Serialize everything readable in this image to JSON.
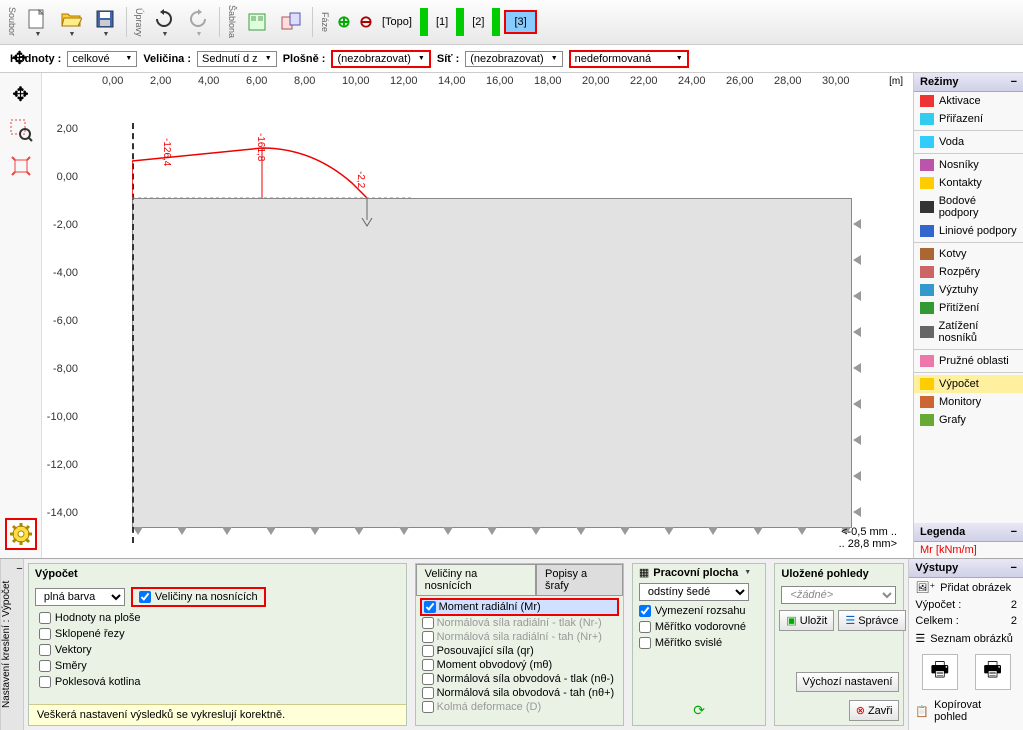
{
  "toolbar": {
    "file_label": "Soubor",
    "edit_label": "Úpravy",
    "template_label": "Šablona",
    "phase_label": "Fáze",
    "phases": [
      "[Topo]",
      "[1]",
      "[2]",
      "[3]"
    ]
  },
  "filters": {
    "hodnoty_label": "Hodnoty :",
    "hodnoty_value": "celkové",
    "velicina_label": "Veličina :",
    "velicina_value": "Sednutí d z",
    "plosne_label": "Plošně :",
    "plosne_value": "(nezobrazovat)",
    "sit_label": "Síť :",
    "sit_value": "(nezobrazovat)",
    "deform_value": "nedeformovaná"
  },
  "ruler": {
    "unit": "[m]",
    "x": [
      "0,00",
      "2,00",
      "4,00",
      "6,00",
      "8,00",
      "10,00",
      "12,00",
      "14,00",
      "16,00",
      "18,00",
      "20,00",
      "22,00",
      "24,00",
      "26,00",
      "28,00",
      "30,00"
    ],
    "y": [
      "2,00",
      "0,00",
      "-2,00",
      "-4,00",
      "-6,00",
      "-8,00",
      "-10,00",
      "-12,00",
      "-14,00"
    ]
  },
  "chart_data": {
    "type": "line",
    "title": "",
    "xlabel": "[m]",
    "ylabel": "",
    "xlim": [
      0,
      30
    ],
    "ylim": [
      -14,
      2
    ],
    "annotations": [
      "-126,4",
      "-161,8",
      "-2,2"
    ],
    "series": [
      {
        "name": "Mr",
        "color": "#e00000",
        "x": [
          0,
          1,
          2,
          3,
          4,
          5,
          6,
          7,
          8,
          8.5
        ],
        "y": [
          1.0,
          1.1,
          1.1,
          1.2,
          1.3,
          1.3,
          1.2,
          0.7,
          0.1,
          0.0
        ]
      }
    ],
    "region": {
      "x": [
        0,
        30
      ],
      "y": [
        -12.5,
        0
      ],
      "fill": "#e2e2e2"
    }
  },
  "modes": {
    "header": "Režimy",
    "items": [
      "Aktivace",
      "Přiřazení",
      "Voda",
      "Nosníky",
      "Kontakty",
      "Bodové podpory",
      "Liniové podpory",
      "Kotvy",
      "Rozpěry",
      "Výztuhy",
      "Přitížení",
      "Zatížení nosníků",
      "Pružné oblasti",
      "Výpočet",
      "Monitory",
      "Grafy"
    ],
    "active": "Výpočet"
  },
  "legend": {
    "header": "Legenda",
    "var": "Mr [kNm/m]",
    "range_lo": "<-0,5 mm ..",
    "range_hi": ".. 28,8 mm>"
  },
  "vypocet": {
    "side_label": "Nastavení kreslení : Výpočet",
    "header": "Výpočet",
    "fill_value": "plná barva",
    "chk_nosniky": "Veličiny na nosnících",
    "opts": [
      "Hodnoty na ploše",
      "Sklopené řezy",
      "Vektory",
      "Směry",
      "Poklesová kotlina"
    ],
    "hint": "Veškerá nastavení výsledků se vykreslují korektně."
  },
  "veliciny": {
    "tab1": "Veličiny na nosnících",
    "tab2": "Popisy a šrafy",
    "items": [
      {
        "label": "Moment radiální (Mr)",
        "checked": true,
        "hl": true
      },
      {
        "label": "Normálová síla radiální - tlak (Nr-)",
        "dis": true
      },
      {
        "label": "Normálová sila radiální - tah (Nr+)",
        "dis": true
      },
      {
        "label": "Posouvající síla (qr)"
      },
      {
        "label": "Moment obvodový (mθ)"
      },
      {
        "label": "Normálová síla obvodová - tlak (nθ-)"
      },
      {
        "label": "Normálová sila obvodová - tah (nθ+)"
      },
      {
        "label": "Kolmá deformace (D)",
        "dis": true
      }
    ]
  },
  "plocha": {
    "header": "Pracovní plocha",
    "shade": "odstíny šedé",
    "opts": [
      "Vymezení rozsahu",
      "Měřítko vodorovné",
      "Měřítko svislé"
    ]
  },
  "pohledy": {
    "header": "Uložené pohledy",
    "none": "<žádné>",
    "save": "Uložit",
    "manage": "Správce",
    "default": "Výchozí nastavení",
    "close": "Zavři"
  },
  "outputs": {
    "header": "Výstupy",
    "add_img": "Přidat obrázek",
    "rows": [
      [
        "Výpočet :",
        "2"
      ],
      [
        "Celkem :",
        "2"
      ]
    ],
    "list": "Seznam obrázků",
    "copy": "Kopírovat pohled"
  }
}
